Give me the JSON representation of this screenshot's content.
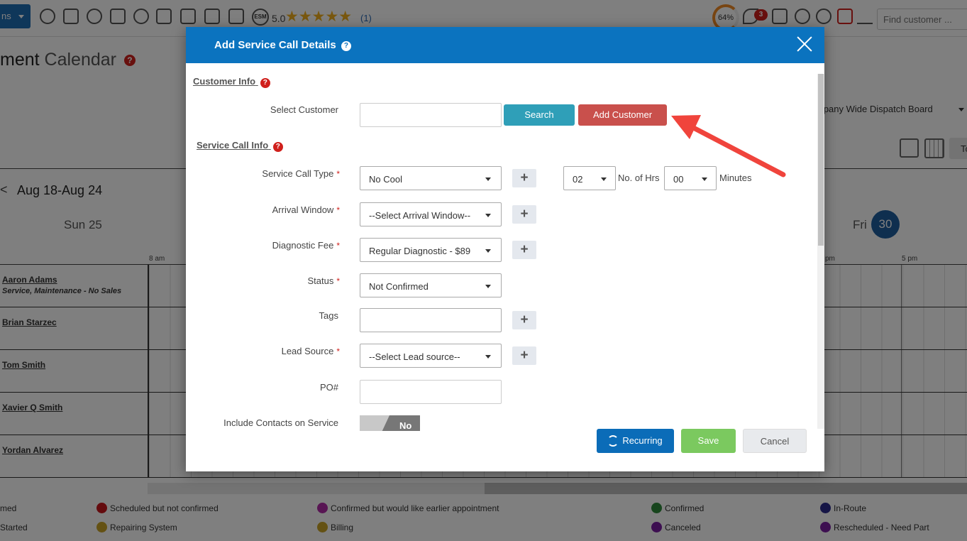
{
  "topbar": {
    "menu_label": "ns",
    "rating_value": "5.0",
    "stars": "★★★★★",
    "rating_count": "(1)",
    "esm_label": "ESM",
    "progress_text": "64%",
    "notifications_count": "3",
    "find_placeholder": "Find customer ..."
  },
  "page": {
    "title_dark": "ment",
    "title_light": "Calendar",
    "help_mark": "?",
    "dispatch_board": "mpany Wide Dispatch Board",
    "today_label": "To"
  },
  "calendar": {
    "prev_arrow": "<",
    "week_range": "Aug 18-Aug 24",
    "sunday_label": "Sun   25",
    "friday_label": "Fri",
    "friday_num": "30",
    "time_labels": [
      "8 am",
      "pm",
      "5 pm"
    ],
    "technicians": [
      {
        "name": "Aaron Adams",
        "subtitle": "Service, Maintenance - No Sales"
      },
      {
        "name": "Brian Starzec"
      },
      {
        "name": "Tom Smith"
      },
      {
        "name": "Xavier Q Smith"
      },
      {
        "name": "Yordan Alvarez"
      }
    ]
  },
  "legend": [
    {
      "label": "med",
      "color": ""
    },
    {
      "label": "Scheduled but not confirmed",
      "color": "#c8161d"
    },
    {
      "label": "Confirmed but would like earlier appointment",
      "color": "#b02aa6"
    },
    {
      "label": "Confirmed",
      "color": "#2e8b3a"
    },
    {
      "label": "In-Route",
      "color": "#2a2a8c"
    },
    {
      "label": "Started",
      "color": ""
    },
    {
      "label": "Repairing System",
      "color": "#c9a227"
    },
    {
      "label": "Billing",
      "color": "#c9a227"
    },
    {
      "label": "Canceled",
      "color": "#7b1fa2"
    },
    {
      "label": "Rescheduled - Need Part",
      "color": "#7b1fa2"
    }
  ],
  "modal": {
    "title": "Add Service Call Details",
    "help_mark": "?",
    "customer_section": "Customer Info",
    "select_customer_label": "Select Customer",
    "search_button": "Search",
    "add_customer_button": "Add Customer",
    "service_section": "Service Call Info",
    "required_mark": "*",
    "fields": {
      "service_call_type": {
        "label": "Service Call Type",
        "value": "No Cool"
      },
      "hours": {
        "value": "02",
        "suffix": "No. of Hrs"
      },
      "minutes": {
        "value": "00",
        "suffix": "Minutes"
      },
      "arrival_window": {
        "label": "Arrival Window",
        "value": "--Select Arrival Window--"
      },
      "diagnostic_fee": {
        "label": "Diagnostic Fee",
        "value": "Regular Diagnostic - $89"
      },
      "status": {
        "label": "Status",
        "value": "Not Confirmed"
      },
      "tags": {
        "label": "Tags"
      },
      "lead_source": {
        "label": "Lead Source",
        "value": "--Select Lead source--"
      },
      "po": {
        "label": "PO#"
      },
      "include_contacts": {
        "label": "Include Contacts on Service",
        "toggle": "No"
      }
    },
    "plus": "+",
    "recurring_button": "Recurring",
    "save_button": "Save",
    "cancel_button": "Cancel"
  },
  "colors": {
    "modal_header": "#0b73bf",
    "search_button": "#2f9fb8",
    "add_customer_button": "#c9504c",
    "save_button": "#7bc95f",
    "annotation_arrow": "#f0443c"
  }
}
